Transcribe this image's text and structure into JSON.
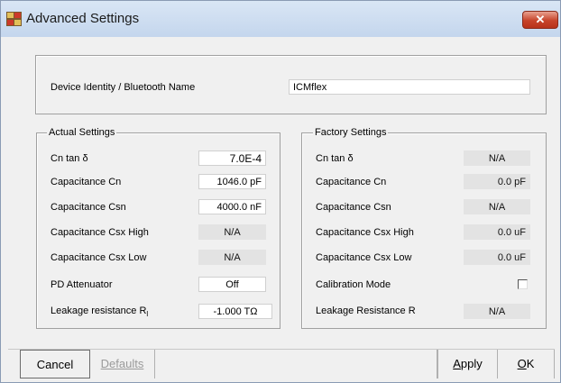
{
  "window": {
    "title": "Advanced Settings",
    "close_symbol": "✕"
  },
  "identity": {
    "label": "Device Identity / Bluetooth Name",
    "value": "ICMflex"
  },
  "actual": {
    "legend": "Actual Settings",
    "rows": [
      {
        "label": "Cn tan δ",
        "value": "7.0E-4",
        "style": "white"
      },
      {
        "label": "Capacitance Cn",
        "value": "1046.0 pF",
        "style": "white"
      },
      {
        "label": "Capacitance Csn",
        "value": "4000.0 nF",
        "style": "white"
      },
      {
        "label": "Capacitance Csx High",
        "value": "N/A",
        "style": "grey"
      },
      {
        "label": "Capacitance Csx Low",
        "value": "N/A",
        "style": "grey"
      },
      {
        "label": "PD Attenuator",
        "value": "Off",
        "style": "white"
      },
      {
        "label": "Leakage resistance R",
        "label_sub": "l",
        "value": "-1.000 TΩ",
        "style": "white"
      }
    ]
  },
  "factory": {
    "legend": "Factory Settings",
    "rows": [
      {
        "label": "Cn tan δ",
        "value": "N/A"
      },
      {
        "label": "Capacitance Cn",
        "value": "0.0 pF"
      },
      {
        "label": "Capacitance Csn",
        "value": "N/A"
      },
      {
        "label": "Capacitance Csx High",
        "value": "0.0 uF"
      },
      {
        "label": "Capacitance Csx Low",
        "value": "0.0 uF"
      },
      {
        "label": "Calibration Mode",
        "checkbox_checked": false
      },
      {
        "label": "Leakage Resistance R",
        "value": "N/A"
      }
    ]
  },
  "buttons": {
    "cancel": "Cancel",
    "defaults": "Defaults",
    "apply": "Apply",
    "ok": "OK"
  }
}
